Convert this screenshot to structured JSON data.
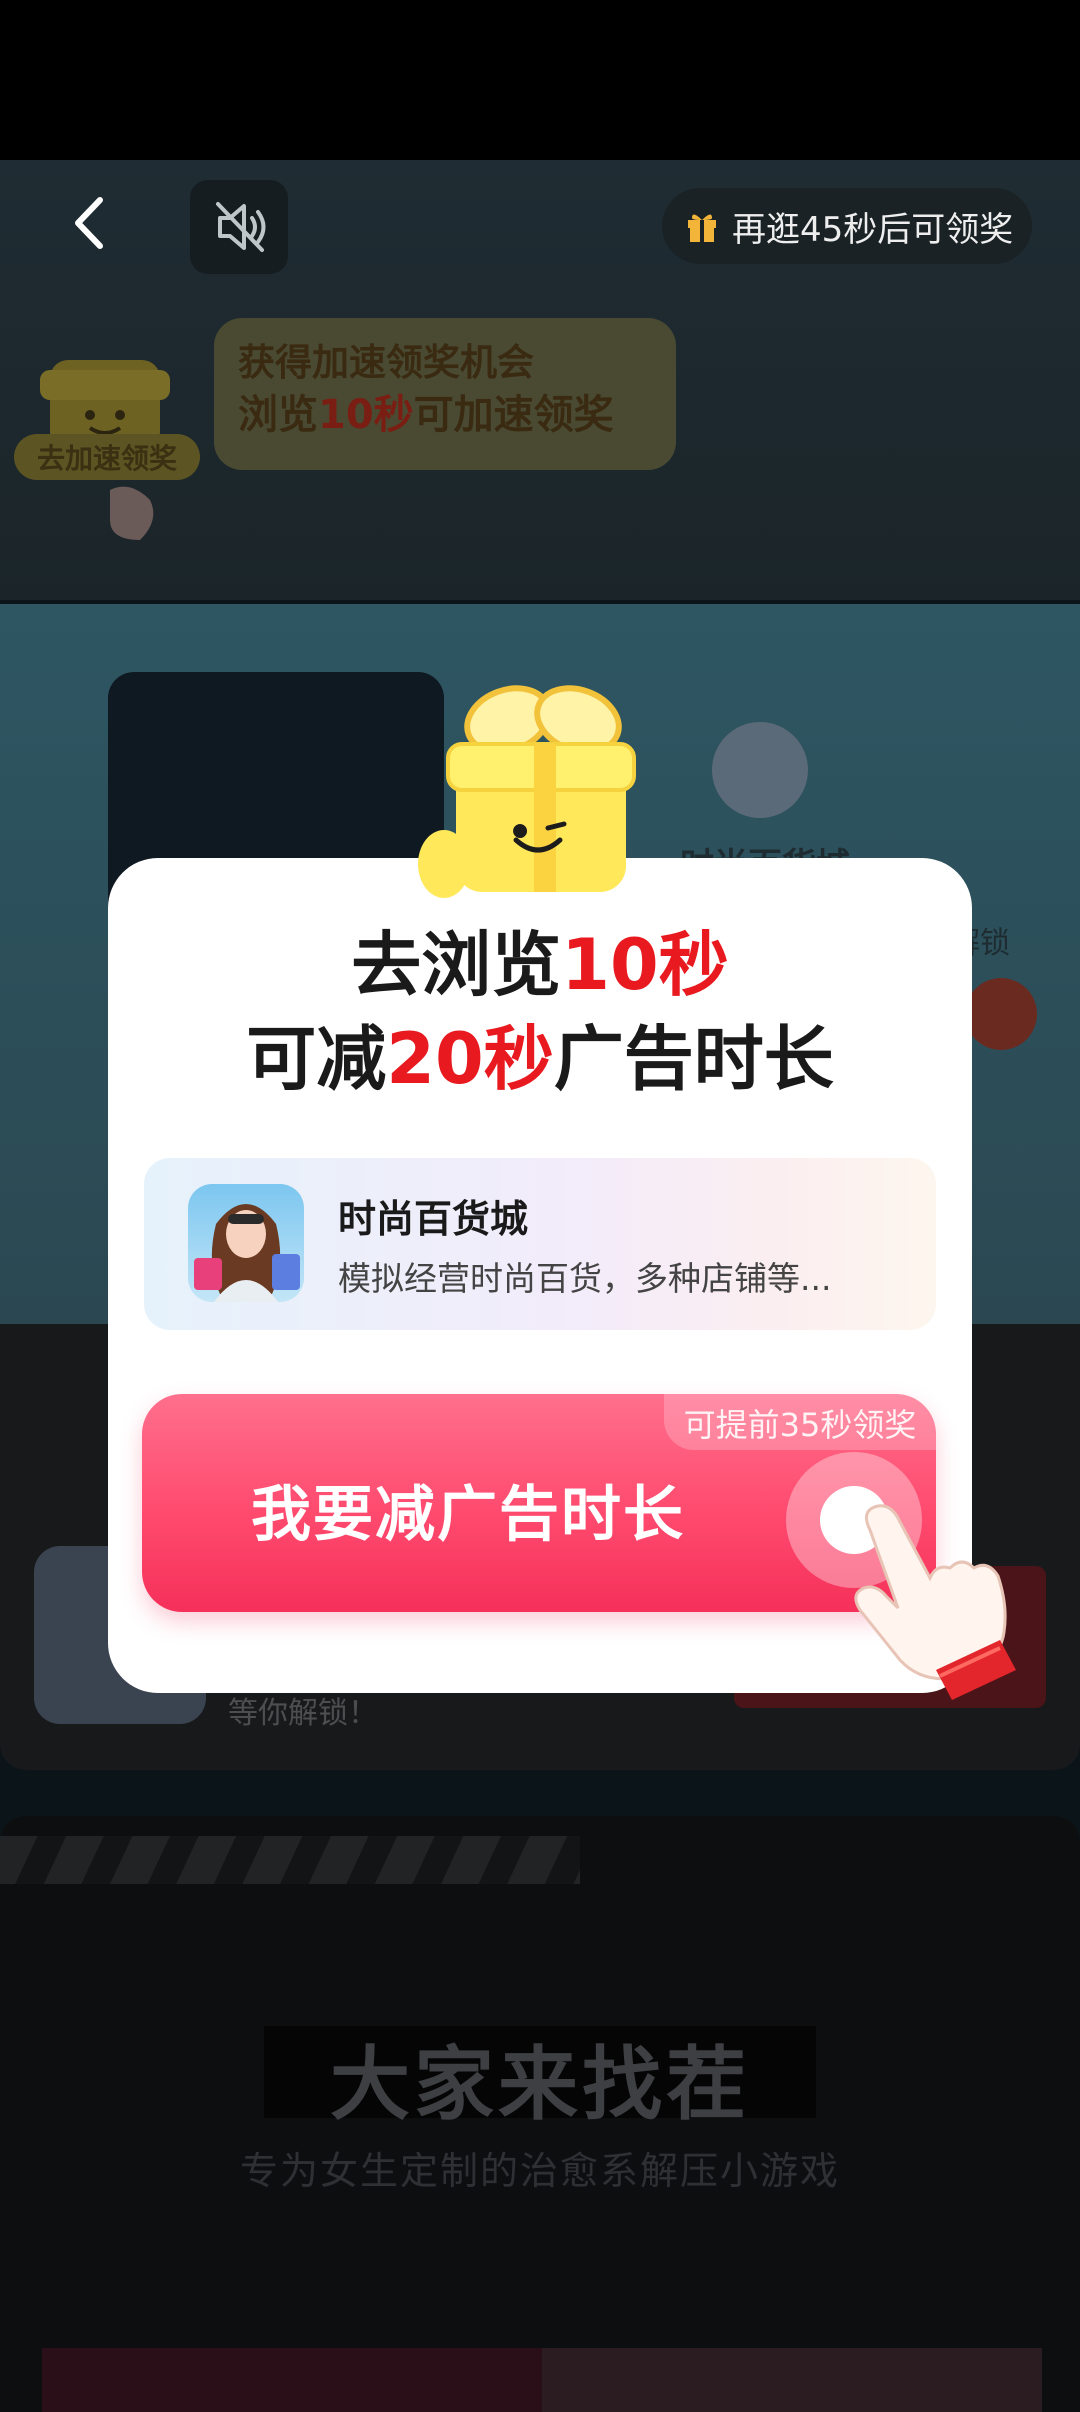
{
  "header": {
    "reward_timer_text": "再逛45秒后可领奖"
  },
  "speed_hint": {
    "badge_label": "去加速领奖",
    "line1": "获得加速领奖机会",
    "line2_prefix": "浏览",
    "line2_highlight": "10秒",
    "line2_suffix": "可加速领奖"
  },
  "background_content": {
    "app_title_partial": "时尚百货城",
    "unlock_partial": "解锁",
    "row_desc_partial": "等你解锁！",
    "game_title": "大家来找茬",
    "game_subtitle": "专为女生定制的治愈系解压小游戏"
  },
  "modal": {
    "title_line1_prefix": "去浏览",
    "title_line1_highlight": "10秒",
    "title_line2_prefix": "可减",
    "title_line2_highlight": "20秒",
    "title_line2_suffix": "广告时长",
    "app_name": "时尚百货城",
    "app_description": "模拟经营时尚百货，多种店铺等...",
    "cta_tag": "可提前35秒领奖",
    "cta_label": "我要减广告时长"
  },
  "colors": {
    "accent_red": "#e8191f",
    "cta_pink": "#ff4a6e",
    "gift_gold": "#f2b53a"
  }
}
